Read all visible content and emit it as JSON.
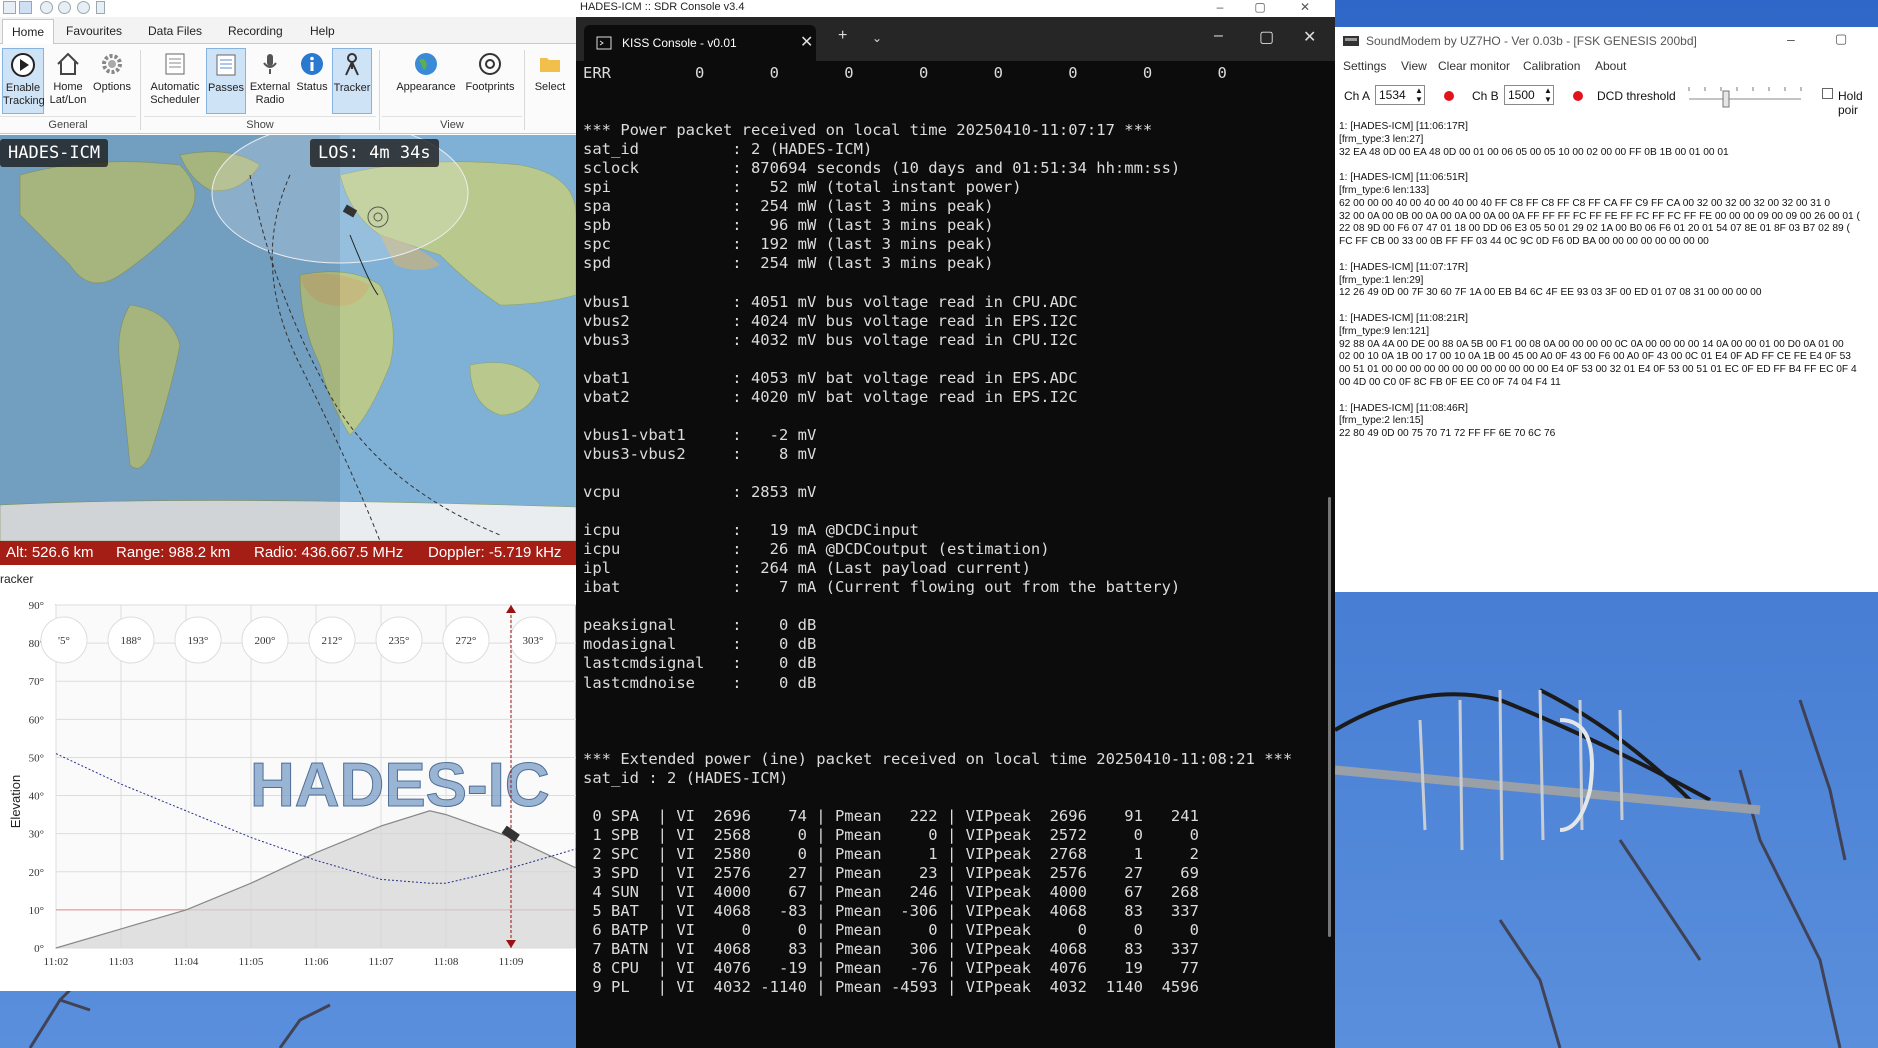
{
  "taskbar": {
    "title": "HADES-ICM :: SDR Console v3.4",
    "win_buttons": [
      "–",
      "▢",
      "✕"
    ]
  },
  "ribbon": {
    "tabs": [
      "Home",
      "Favourites",
      "Data Files",
      "Recording",
      "Help"
    ],
    "groups": {
      "general": "General",
      "show": "Show",
      "view": "View"
    },
    "buttons": {
      "enable_tracking": "Enable Tracking",
      "home": "Home Lat/Lon",
      "options": "Options",
      "auto_scheduler": "Automatic Scheduler",
      "passes": "Passes",
      "external_radio": "External Radio",
      "status": "Status",
      "tracker": "Tracker",
      "appearance": "Appearance",
      "footprints": "Footprints",
      "select": "Select"
    }
  },
  "map": {
    "sat_name": "HADES-ICM",
    "los": "LOS: 4m 34s"
  },
  "infobar": {
    "alt": "Alt: 526.6 km",
    "range": "Range: 988.2 km",
    "radio": "Radio: 436.667.5 MHz",
    "doppler": "Doppler: -5.719 kHz"
  },
  "tracker": {
    "caption": "racker",
    "watermark": "HADES-IC",
    "ylabel": "Elevation",
    "yticks": [
      "0°",
      "10°",
      "20°",
      "30°",
      "40°",
      "50°",
      "60°",
      "70°",
      "80°",
      "90°"
    ],
    "xticks": [
      "11:02",
      "11:03",
      "11:04",
      "11:05",
      "11:06",
      "11:07",
      "11:08",
      "11:09"
    ],
    "azimuths": [
      "'5°",
      "188°",
      "193°",
      "200°",
      "212°",
      "235°",
      "272°",
      "303°"
    ]
  },
  "chart_data": {
    "type": "line",
    "xlabel": "",
    "ylabel": "Elevation",
    "ylim": [
      0,
      90
    ],
    "xlim": [
      "11:02",
      "11:10"
    ],
    "x": [
      "11:02",
      "11:03",
      "11:04",
      "11:05",
      "11:06",
      "11:07",
      "11:07:45",
      "11:08",
      "11:09",
      "11:10"
    ],
    "series": [
      {
        "values": [
          0,
          5,
          10,
          17,
          25,
          32,
          36,
          35,
          29,
          21
        ]
      },
      {
        "values": [
          51,
          43,
          36,
          29,
          23,
          18,
          17,
          17,
          21,
          26
        ]
      }
    ],
    "current_time": "11:09"
  },
  "kiss": {
    "tab_title": "KISS Console - v0.01",
    "lines": [
      "ERR         0       0       0       0       0       0       0       0",
      "",
      "",
      "*** Power packet received on local time 20250410-11:07:17 ***",
      "sat_id          : 2 (HADES-ICM)",
      "sclock          : 870694 seconds (10 days and 01:51:34 hh:mm:ss)",
      "spi             :   52 mW (total instant power)",
      "spa             :  254 mW (last 3 mins peak)",
      "spb             :   96 mW (last 3 mins peak)",
      "spc             :  192 mW (last 3 mins peak)",
      "spd             :  254 mW (last 3 mins peak)",
      "",
      "vbus1           : 4051 mV bus voltage read in CPU.ADC",
      "vbus2           : 4024 mV bus voltage read in EPS.I2C",
      "vbus3           : 4032 mV bus voltage read in CPU.I2C",
      "",
      "vbat1           : 4053 mV bat voltage read in EPS.ADC",
      "vbat2           : 4020 mV bat voltage read in EPS.I2C",
      "",
      "vbus1-vbat1     :   -2 mV",
      "vbus3-vbus2     :    8 mV",
      "",
      "vcpu            : 2853 mV",
      "",
      "icpu            :   19 mA @DCDCinput",
      "icpu            :   26 mA @DCDCoutput (estimation)",
      "ipl             :  264 mA (Last payload current)",
      "ibat            :    7 mA (Current flowing out from the battery)",
      "",
      "peaksignal      :    0 dB",
      "modasignal      :    0 dB",
      "lastcmdsignal   :    0 dB",
      "lastcmdnoise    :    0 dB",
      "",
      "",
      "",
      "*** Extended power (ine) packet received on local time 20250410-11:08:21 ***",
      "sat_id : 2 (HADES-ICM)",
      "",
      " 0 SPA  | VI  2696    74 | Pmean   222 | VIPpeak  2696    91   241",
      " 1 SPB  | VI  2568     0 | Pmean     0 | VIPpeak  2572     0     0",
      " 2 SPC  | VI  2580     0 | Pmean     1 | VIPpeak  2768     1     2",
      " 3 SPD  | VI  2576    27 | Pmean    23 | VIPpeak  2576    27    69",
      " 4 SUN  | VI  4000    67 | Pmean   246 | VIPpeak  4000    67   268",
      " 5 BAT  | VI  4068   -83 | Pmean  -306 | VIPpeak  4068    83   337",
      " 6 BATP | VI     0     0 | Pmean     0 | VIPpeak     0     0     0",
      " 7 BATN | VI  4068    83 | Pmean   306 | VIPpeak  4068    83   337",
      " 8 CPU  | VI  4076   -19 | Pmean   -76 | VIPpeak  4076    19    77",
      " 9 PL   | VI  4032 -1140 | Pmean -4593 | VIPpeak  4032  1140  4596"
    ]
  },
  "soundmodem": {
    "title": "SoundModem by UZ7HO - Ver 0.03b - [FSK GENESIS 200bd]",
    "menu": [
      "Settings",
      "View",
      "Clear monitor",
      "Calibration",
      "About"
    ],
    "cha_label": "Ch A",
    "cha_value": "1534",
    "chb_label": "Ch B",
    "chb_value": "1500",
    "dcd_label": "DCD threshold",
    "hold_label": "Hold poir",
    "log": "1: [HADES-ICM] [11:06:17R]\n[frm_type:3 len:27]\n32 EA 48 0D 00 EA 48 0D 00 01 00 06 05 00 05 10 00 02 00 00 FF 0B 1B 00 01 00 01\n\n1: [HADES-ICM] [11:06:51R]\n[frm_type:6 len:133]\n62 00 00 00 40 00 40 00 40 00 40 FF C8 FF C8 FF C8 FF CA FF C9 FF CA 00 32 00 32 00 32 00 32 00 31 0\n32 00 0A 00 0B 00 0A 00 0A 00 0A 00 0A FF FF FF FC FF FE FF FC FF FC FF FE 00 00 00 09 00 09 00 26 00 01 (\n22 08 9D 00 F6 07 47 01 18 00 DD 06 E3 05 50 01 29 02 1A 00 B0 06 F6 01 20 01 54 07 8E 01 8F 03 B7 02 89 (\nFC FF CB 00 33 00 0B FF FF 03 44 0C 9C 0D F6 0D BA 00 00 00 00 00 00 00 00\n\n1: [HADES-ICM] [11:07:17R]\n[frm_type:1 len:29]\n12 26 49 0D 00 7F 30 60 7F 1A 00 EB B4 6C 4F EE 93 03 3F 00 ED 01 07 08 31 00 00 00 00\n\n1: [HADES-ICM] [11:08:21R]\n[frm_type:9 len:121]\n92 88 0A 4A 00 DE 00 88 0A 5B 00 F1 00 08 0A 00 00 00 00 0C 0A 00 00 00 00 14 0A 00 00 01 00 D0 0A 01 00\n02 00 10 0A 1B 00 17 00 10 0A 1B 00 45 00 A0 0F 43 00 F6 00 A0 0F 43 00 0C 01 E4 0F AD FF CE FE E4 0F 53\n00 51 01 00 00 00 00 00 00 00 00 00 00 00 00 E4 0F 53 00 32 01 E4 0F 53 00 51 01 EC 0F ED FF B4 FF EC 0F 4\n00 4D 00 C0 0F 8C FB 0F EE C0 0F 74 04 F4 11\n\n1: [HADES-ICM] [11:08:46R]\n[frm_type:2 len:15]\n22 80 49 0D 00 75 70 71 72 FF FF 6E 70 6C 76",
    "scale": [
      "1000",
      "2000"
    ]
  }
}
